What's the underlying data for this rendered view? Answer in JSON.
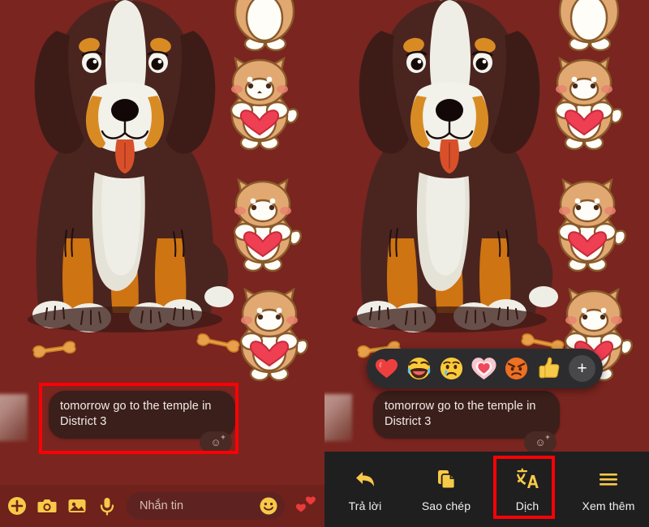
{
  "app": {
    "name": "Messenger chat",
    "wallpaper_color": "#7a2520",
    "accent_color": "#f7c948",
    "annotation_color": "#fd0006"
  },
  "conversation": {
    "message": {
      "text": "tomorrow go to the temple in District 3",
      "line1": "tomorrow go to the temple in",
      "line2": "District 3",
      "sender": "other",
      "react_button_label": "Add reaction"
    }
  },
  "composer": {
    "placeholder": "Nhắn tin",
    "buttons": [
      {
        "name": "plus-circle-icon",
        "label": "Thêm"
      },
      {
        "name": "camera-icon",
        "label": "Máy ảnh"
      },
      {
        "name": "gallery-icon",
        "label": "Thư viện"
      },
      {
        "name": "microphone-icon",
        "label": "Ghi âm"
      }
    ],
    "emoji_button": "smiley-icon",
    "quick_reaction": "hearts-icon"
  },
  "reaction_bar": {
    "reactions": [
      {
        "name": "heart-reaction",
        "label": "Yêu thích",
        "emoji": "red-heart"
      },
      {
        "name": "laugh-reaction",
        "label": "Haha",
        "emoji": "rolling-on-floor-laughing"
      },
      {
        "name": "sad-reaction",
        "label": "Buồn",
        "emoji": "crying-face"
      },
      {
        "name": "love-reaction",
        "label": "Thương thương",
        "emoji": "growing-heart"
      },
      {
        "name": "angry-reaction",
        "label": "Phẫn nộ",
        "emoji": "angry-face"
      },
      {
        "name": "like-reaction",
        "label": "Thích",
        "emoji": "thumbs-up"
      }
    ],
    "more_label": "+"
  },
  "action_bar": {
    "items": [
      {
        "label": "Trả lời",
        "icon": "reply-arrow-icon",
        "highlighted": false
      },
      {
        "label": "Sao chép",
        "icon": "copy-icon",
        "highlighted": false
      },
      {
        "label": "Dịch",
        "icon": "translate-icon",
        "highlighted": true
      },
      {
        "label": "Xem thêm",
        "icon": "hamburger-menu-icon",
        "highlighted": false
      }
    ]
  },
  "annotations": [
    {
      "name": "message-highlight",
      "target": "message bubble"
    },
    {
      "name": "dich-highlight",
      "target": "Dịch"
    }
  ],
  "wallpaper": {
    "main_illustration": "bernese-mountain-dog",
    "stickers": "shiba-inu-with-heart",
    "decorations": "dog-bone"
  }
}
